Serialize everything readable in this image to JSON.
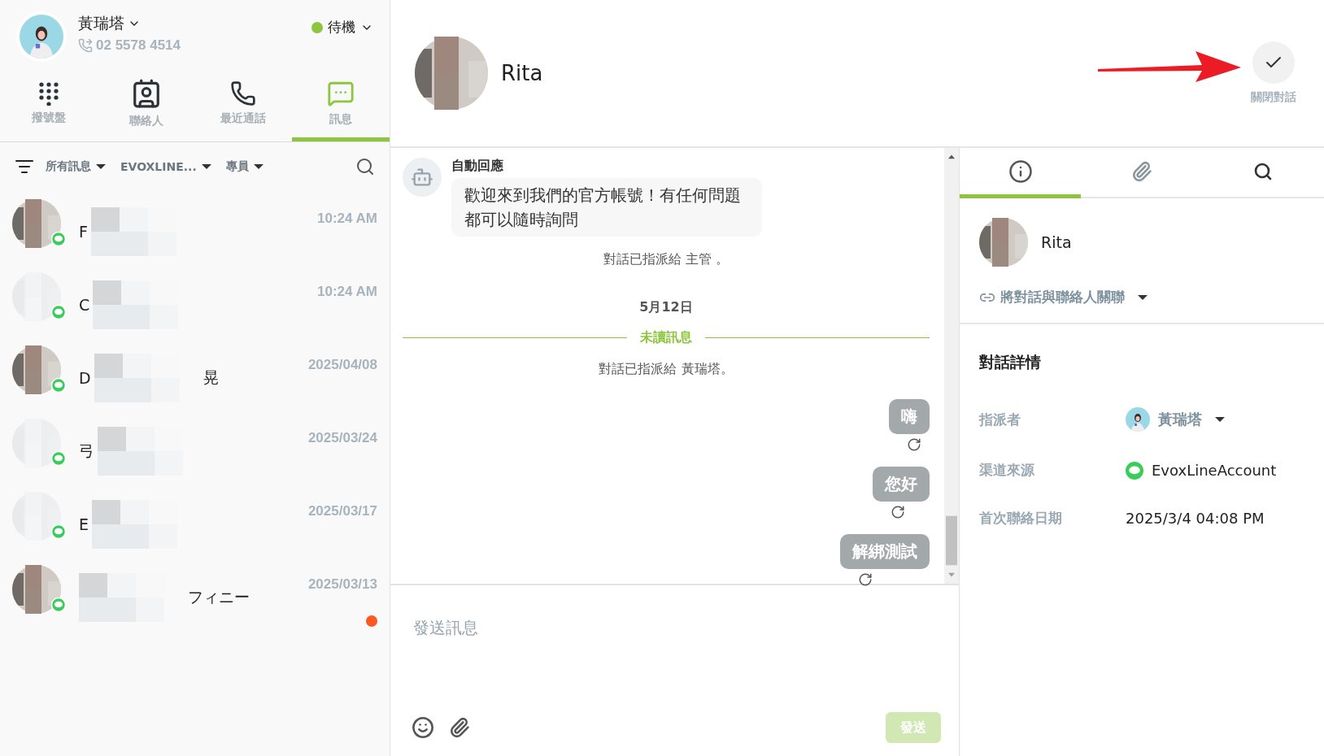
{
  "agent": {
    "name": "黃瑞塔",
    "phone": "02 5578 4514",
    "status": "待機",
    "online": true
  },
  "nav_tabs": [
    {
      "kind": "dialpad",
      "label": "撥號盤",
      "selected": false
    },
    {
      "kind": "contacts",
      "label": "聯絡人",
      "selected": false
    },
    {
      "kind": "calls",
      "label": "最近通話",
      "selected": false
    },
    {
      "kind": "messages",
      "label": "訊息",
      "selected": true
    }
  ],
  "filters": [
    {
      "label": "所有訊息"
    },
    {
      "label": "EVOXLINE..."
    },
    {
      "label": "專員"
    }
  ],
  "conversations": [
    {
      "name_start": "F",
      "time": "10:24 AM",
      "unread": false
    },
    {
      "name_start": "C",
      "time": "10:24 AM",
      "unread": false,
      "kind": "blank"
    },
    {
      "name_start": "D",
      "name_end": "晃",
      "time": "2025/04/08",
      "unread": false
    },
    {
      "name_start": "弓",
      "time": "2025/03/24",
      "unread": false,
      "kind": "blank"
    },
    {
      "name_start": "E",
      "time": "2025/03/17",
      "unread": false,
      "kind": "blank"
    },
    {
      "name_end": "フィニー",
      "time": "2025/03/13",
      "unread": true
    }
  ],
  "chat": {
    "contact": "Rita",
    "close_label": "關閉對話",
    "messages": [
      {
        "kind": "bot",
        "sender": "自動回應",
        "text": "歡迎來到我們的官方帳號！有任何問題都可以隨時詢問"
      },
      {
        "kind": "system",
        "text": "對話已指派給 主管 。"
      },
      {
        "kind": "date",
        "text": "5月12日"
      },
      {
        "kind": "divider",
        "text": "未讀訊息"
      },
      {
        "kind": "system",
        "text": "對話已指派給 黃瑞塔。"
      },
      {
        "kind": "outgoing",
        "text": "嗨"
      },
      {
        "kind": "outgoing",
        "text": "您好"
      },
      {
        "kind": "outgoing",
        "text": "解綁測試"
      }
    ]
  },
  "composer": {
    "placeholder": "發送訊息",
    "send": "發送",
    "send_disabled": true
  },
  "details": {
    "tabs": [
      {
        "kind": "info",
        "selected": true
      },
      {
        "kind": "attachments",
        "selected": false
      },
      {
        "kind": "search",
        "selected": false
      }
    ],
    "contact": "Rita",
    "link_label": "將對話與聯絡人關聯",
    "title": "對話詳情",
    "fields": [
      {
        "kind": "assignee",
        "label": "指派者",
        "value": "黃瑞塔"
      },
      {
        "kind": "channel",
        "label": "渠道來源",
        "value": "EvoxLineAccount"
      },
      {
        "kind": "text",
        "label": "首次聯絡日期",
        "value": "2025/3/4 04:08 PM"
      }
    ]
  }
}
